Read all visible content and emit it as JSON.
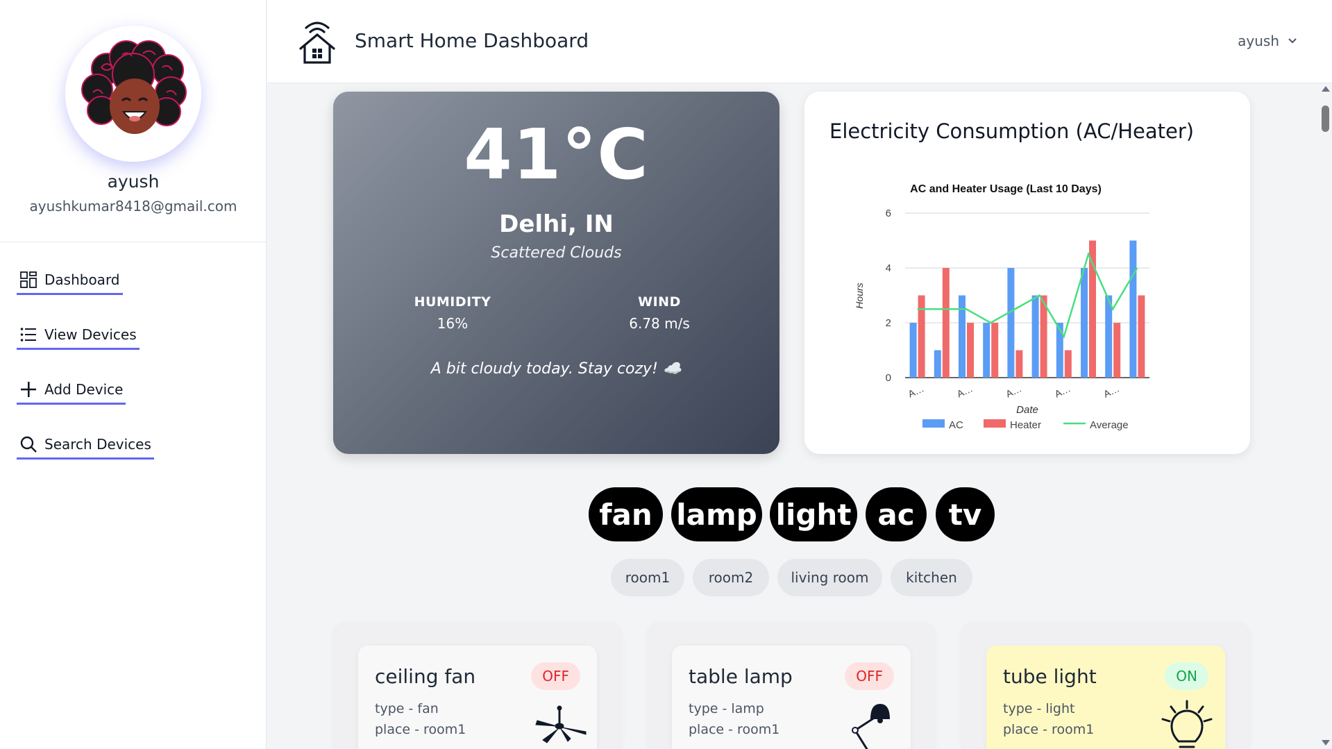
{
  "profile": {
    "name": "ayush",
    "email": "ayushkumar8418@gmail.com"
  },
  "nav": [
    {
      "label": "Dashboard",
      "icon": "dashboard-grid-icon"
    },
    {
      "label": "View Devices",
      "icon": "list-icon"
    },
    {
      "label": "Add Device",
      "icon": "plus-icon"
    },
    {
      "label": "Search Devices",
      "icon": "search-icon"
    }
  ],
  "header": {
    "title": "Smart Home Dashboard",
    "user": "ayush"
  },
  "weather": {
    "temp": "41°C",
    "city": "Delhi, IN",
    "description": "Scattered Clouds",
    "humidity_label": "HUMIDITY",
    "humidity_value": "16%",
    "wind_label": "WIND",
    "wind_value": "6.78 m/s",
    "message": "A bit cloudy today. Stay cozy! ☁️"
  },
  "chart_card": {
    "title": "Electricity Consumption (AC/Heater)"
  },
  "chart_data": {
    "type": "bar",
    "title": "AC and Heater Usage (Last 10 Days)",
    "xlabel": "Date",
    "ylabel": "Hours",
    "ylim": [
      0,
      6
    ],
    "yticks": [
      0,
      2,
      4,
      6
    ],
    "categories": [
      "A…",
      "A…",
      "A…",
      "A…",
      "A…",
      "A…",
      "A…",
      "A…",
      "A…",
      "A…"
    ],
    "tick_labels": [
      "A…",
      "A…",
      "A…",
      "A…",
      "A…"
    ],
    "series": [
      {
        "name": "AC",
        "type": "bar",
        "color": "#5b9cf5",
        "values": [
          2,
          1,
          3,
          2,
          4,
          3,
          2,
          4,
          3,
          5
        ]
      },
      {
        "name": "Heater",
        "type": "bar",
        "color": "#f06a6a",
        "values": [
          3,
          4,
          2,
          2,
          1,
          3,
          1,
          5,
          2,
          3
        ]
      },
      {
        "name": "Average",
        "type": "line",
        "color": "#4ade80",
        "values": [
          2.5,
          2.5,
          2.5,
          2,
          2.5,
          3,
          1.5,
          4.5,
          2.5,
          4
        ]
      }
    ],
    "grid": true,
    "legend": "bottom"
  },
  "device_types": [
    "fan",
    "lamp",
    "light",
    "ac",
    "tv"
  ],
  "rooms": [
    "room1",
    "room2",
    "living room",
    "kitchen"
  ],
  "devices": [
    {
      "name": "ceiling fan",
      "type_line": "type - fan",
      "place_line": "place - room1",
      "status": "OFF",
      "icon": "ceiling-fan-icon"
    },
    {
      "name": "table lamp",
      "type_line": "type - lamp",
      "place_line": "place - room1",
      "status": "OFF",
      "icon": "desk-lamp-icon"
    },
    {
      "name": "tube light",
      "type_line": "type - light",
      "place_line": "place - room1",
      "status": "ON",
      "icon": "light-bulb-icon"
    }
  ],
  "colors": {
    "accent": "#6366f1",
    "on_badge": "#16a34a",
    "off_badge": "#dc2626",
    "on_card": "#fef9c3"
  }
}
